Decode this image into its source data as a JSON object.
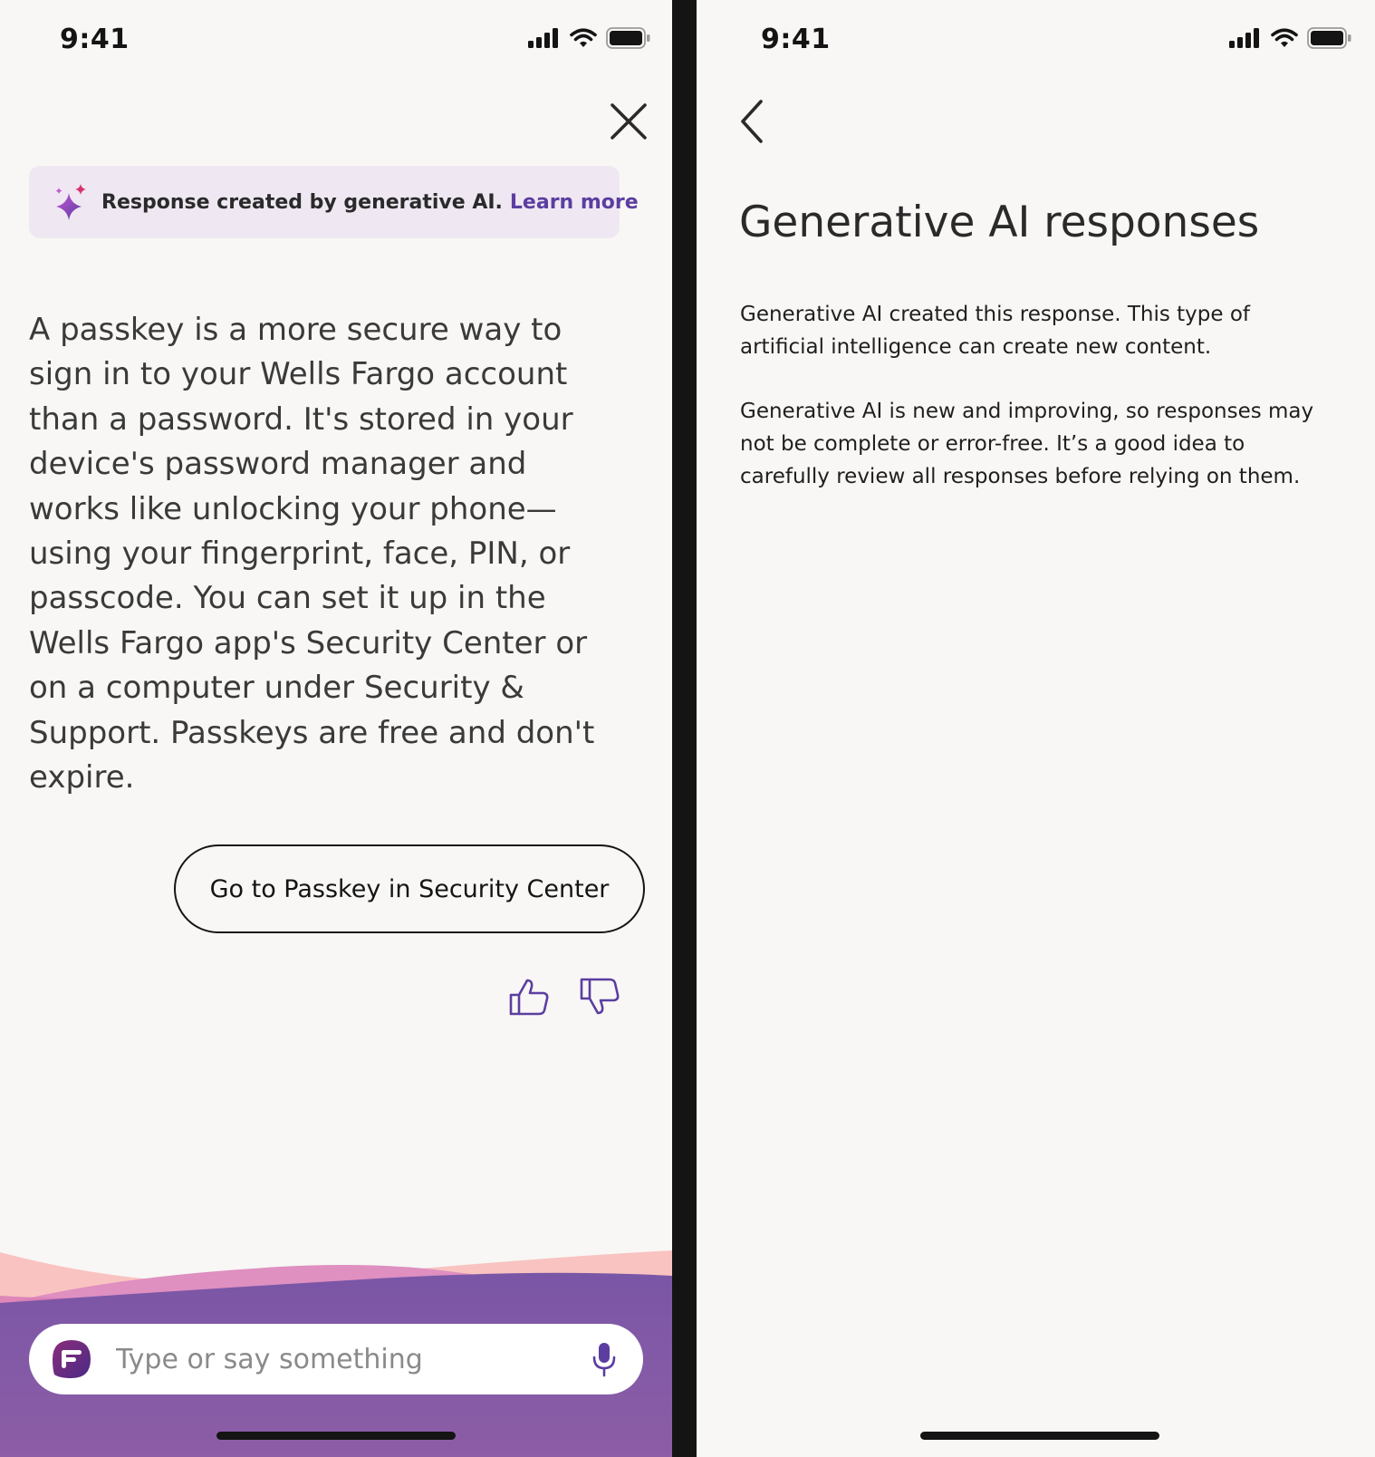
{
  "status_bar": {
    "time": "9:41"
  },
  "chat_screen": {
    "banner": {
      "text": "Response created by generative AI.",
      "link": "Learn more"
    },
    "answer": "A passkey is a more secure way to\nsign in to your Wells Fargo account\nthan a password.  It's stored in your\ndevice's password manager and\nworks like unlocking your phone—\nusing your fingerprint, face, PIN, or\npasscode. You can set it up in the\nWells Fargo app's Security Center or\non a computer under Security &\nSupport.  Passkeys are free and don't\nexpire.",
    "action_button": "Go to Passkey in Security Center",
    "input": {
      "placeholder": "Type or say something"
    }
  },
  "info_screen": {
    "title": "Generative AI responses",
    "paragraphs": [
      "Generative AI created this response. This type of artificial intelligence can create new content.",
      "Generative AI is new and improving, so responses may not be complete or error-free. It’s a good idea to carefully review all responses before relying on them."
    ]
  },
  "icons": {
    "close": "close-icon",
    "back": "chevron-left-icon",
    "sparkle": "sparkle-icon",
    "thumbs_up": "thumbs-up-icon",
    "thumbs_down": "thumbs-down-icon",
    "mic": "microphone-icon",
    "assistant_logo": "assistant-logo-icon"
  },
  "colors": {
    "background": "#f8f7f5",
    "divider": "#141414",
    "accent_purple": "#5b3ea0",
    "banner_bg": "#efe8f2",
    "wave_pink": "#f9c3c1",
    "wave_purple": "#7a56a6"
  }
}
